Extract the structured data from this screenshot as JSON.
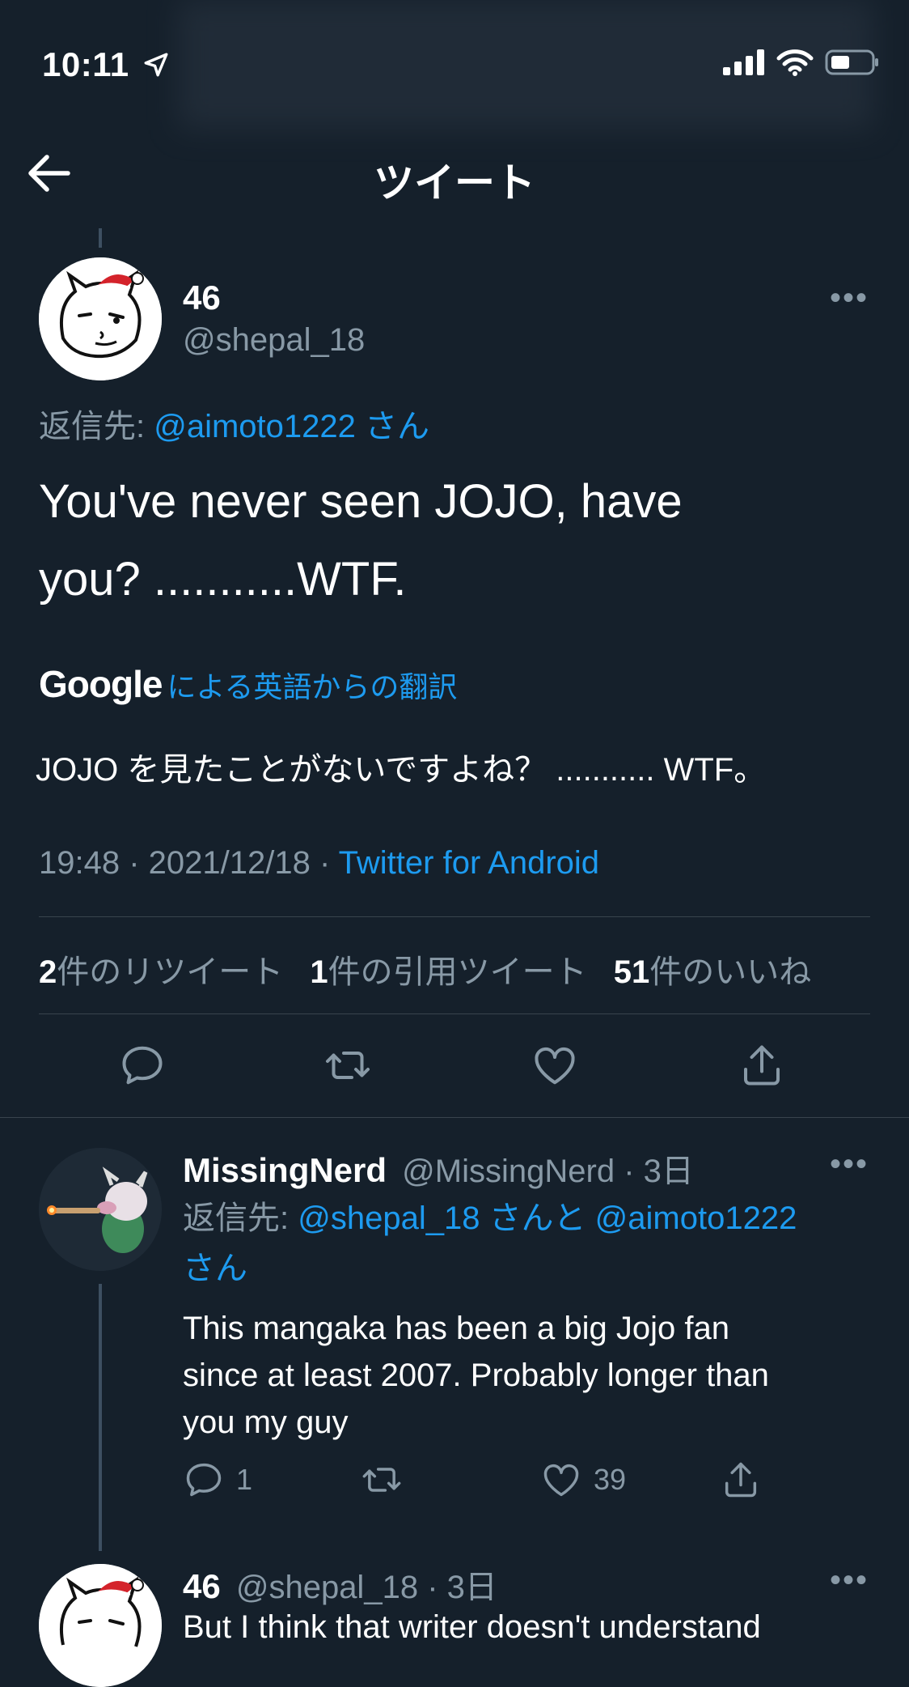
{
  "status_bar": {
    "time": "10:11"
  },
  "header": {
    "title": "ツイート"
  },
  "main_tweet": {
    "name": "46",
    "handle": "@shepal_18",
    "reply_prefix": "返信先: ",
    "reply_to": "@aimoto1222 さん",
    "text_line1": "You've never seen JOJO, have",
    "text_line2": "you? ...........WTF.",
    "google_logo": "Google",
    "translation_label": "による英語からの翻訳",
    "translation": "JOJO を見たことがないですよね？ ........... WTF。",
    "time": "19:48 · 2021/12/18 · ",
    "source": "Twitter for Android",
    "stats": {
      "retweets_num": "2",
      "retweets_label": "件のリツイート",
      "quotes_num": "1",
      "quotes_label": "件の引用ツイート",
      "likes_num": "51",
      "likes_label": "件のいいね"
    }
  },
  "reply1": {
    "name": "MissingNerd",
    "handle": "@MissingNerd",
    "age": "· 3日",
    "reply_prefix": "返信先: ",
    "reply_to_line1": "@shepal_18 さんと @aimoto1222",
    "reply_to_line2": "さん",
    "text_line1": "This mangaka has been a big Jojo fan",
    "text_line2": "since at least 2007. Probably longer than",
    "text_line3": "you my guy",
    "reply_count": "1",
    "like_count": "39"
  },
  "reply2": {
    "name": "46",
    "handle": "@shepal_18",
    "age": "· 3日",
    "text_line1": "But I think that writer doesn't understand"
  },
  "colors": {
    "background": "#15202b",
    "accent": "#1d9bf0",
    "muted": "#8899a6",
    "divider": "#38444d"
  }
}
